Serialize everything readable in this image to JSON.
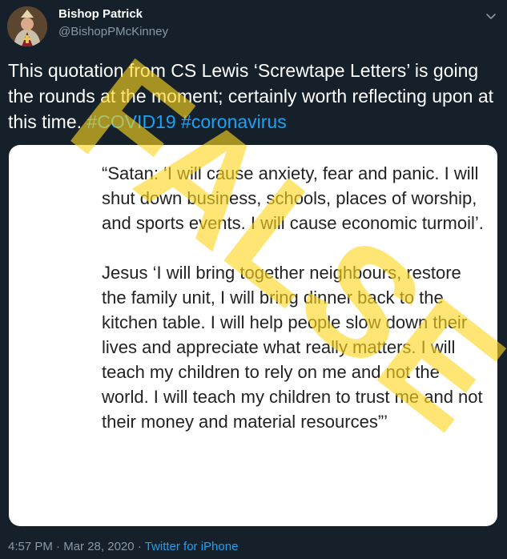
{
  "author": {
    "display_name": "Bishop Patrick",
    "handle": "@BishopPMcKinney"
  },
  "tweet": {
    "text": "This quotation from CS Lewis ‘Screwtape Letters’ is going the rounds at the moment; certainly worth reflecting upon at this time.",
    "hashtags": [
      "#COVID19",
      "#coronavirus"
    ]
  },
  "media": {
    "quote_paragraphs": [
      "“Satan: ‘I will cause anxiety, fear and panic. I will shut down business, schools, places of worship, and sports events. I will cause economic turmoil’.",
      "Jesus ‘I will bring together neighbours, restore the family unit, I will bring dinner back to the kitchen table. I will help people slow down their lives and appreciate what really matters. I will teach my children to rely on me and not the world. I will teach my children to trust me and not their money and material resources”’"
    ]
  },
  "watermark": {
    "text": "FALSE",
    "color": "#ffd61e"
  },
  "footer": {
    "time": "4:57 PM",
    "separator": "·",
    "date": "Mar 28, 2020",
    "source": "Twitter for iPhone"
  },
  "colors": {
    "background": "#15202b",
    "accent": "#1da1f2",
    "secondary_text": "#8899a6"
  },
  "icons": {
    "caret": "chevron-down-icon",
    "avatar": "avatar"
  }
}
